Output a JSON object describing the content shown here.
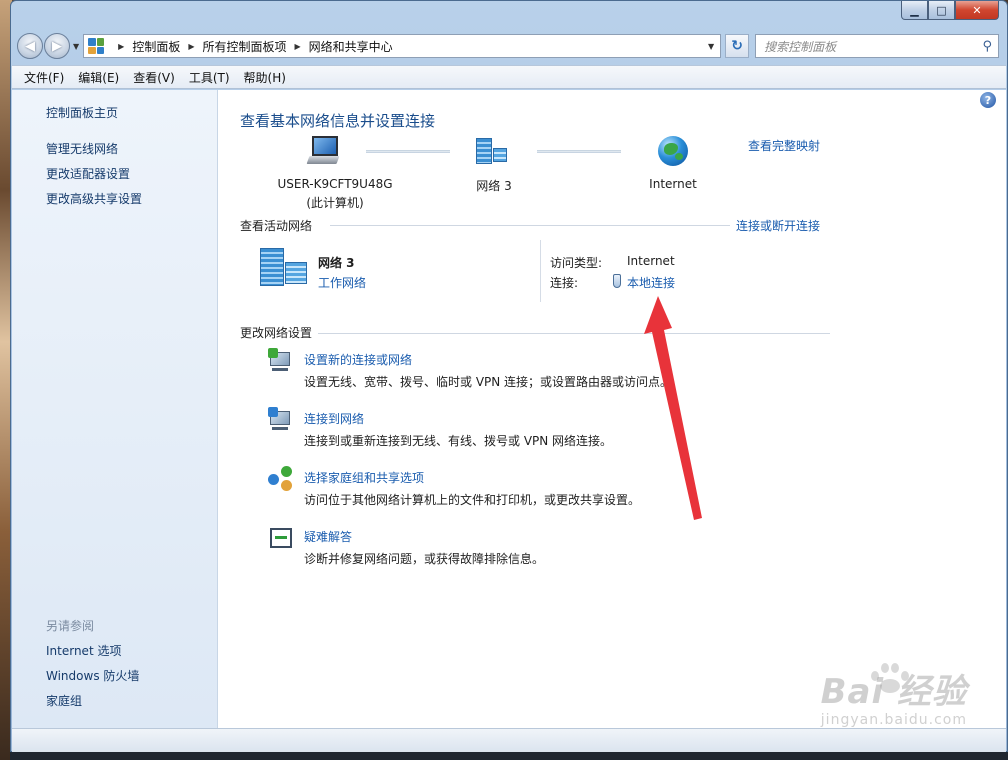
{
  "window": {
    "minimize": "▁",
    "maximize": "□",
    "close": "✕"
  },
  "address_bar": {
    "crumbs": [
      "控制面板",
      "所有控制面板项",
      "网络和共享中心"
    ],
    "search_placeholder": "搜索控制面板"
  },
  "menu": [
    "文件(F)",
    "编辑(E)",
    "查看(V)",
    "工具(T)",
    "帮助(H)"
  ],
  "left_nav": {
    "home": "控制面板主页",
    "tasks": [
      "管理无线网络",
      "更改适配器设置",
      "更改高级共享设置"
    ],
    "see_also_title": "另请参阅",
    "see_also": [
      "Internet 选项",
      "Windows 防火墙",
      "家庭组"
    ]
  },
  "main": {
    "title": "查看基本网络信息并设置连接",
    "view_full_map": "查看完整映射",
    "map": {
      "computer_name": "USER-K9CFT9U48G",
      "computer_sub": "(此计算机)",
      "network_name": "网络  3",
      "internet": "Internet"
    },
    "active_networks": {
      "title": "查看活动网络",
      "connect_link": "连接或断开连接",
      "network_name": "网络  3",
      "network_type": "工作网络",
      "access_type_label": "访问类型:",
      "access_type_value": "Internet",
      "connections_label": "连接:",
      "connections_value": "本地连接"
    },
    "change_settings": {
      "title": "更改网络设置",
      "items": [
        {
          "link": "设置新的连接或网络",
          "desc": "设置无线、宽带、拨号、临时或 VPN 连接；或设置路由器或访问点。"
        },
        {
          "link": "连接到网络",
          "desc": "连接到或重新连接到无线、有线、拨号或 VPN 网络连接。"
        },
        {
          "link": "选择家庭组和共享选项",
          "desc": "访问位于其他网络计算机上的文件和打印机，或更改共享设置。"
        },
        {
          "link": "疑难解答",
          "desc": "诊断并修复网络问题，或获得故障排除信息。"
        }
      ]
    }
  },
  "watermark": {
    "main": "Bai 经验",
    "sub": "jingyan.baidu.com"
  },
  "colors": {
    "link": "#1a5cae",
    "title": "#1a4d8c",
    "annotation_arrow": "#e8333a"
  }
}
